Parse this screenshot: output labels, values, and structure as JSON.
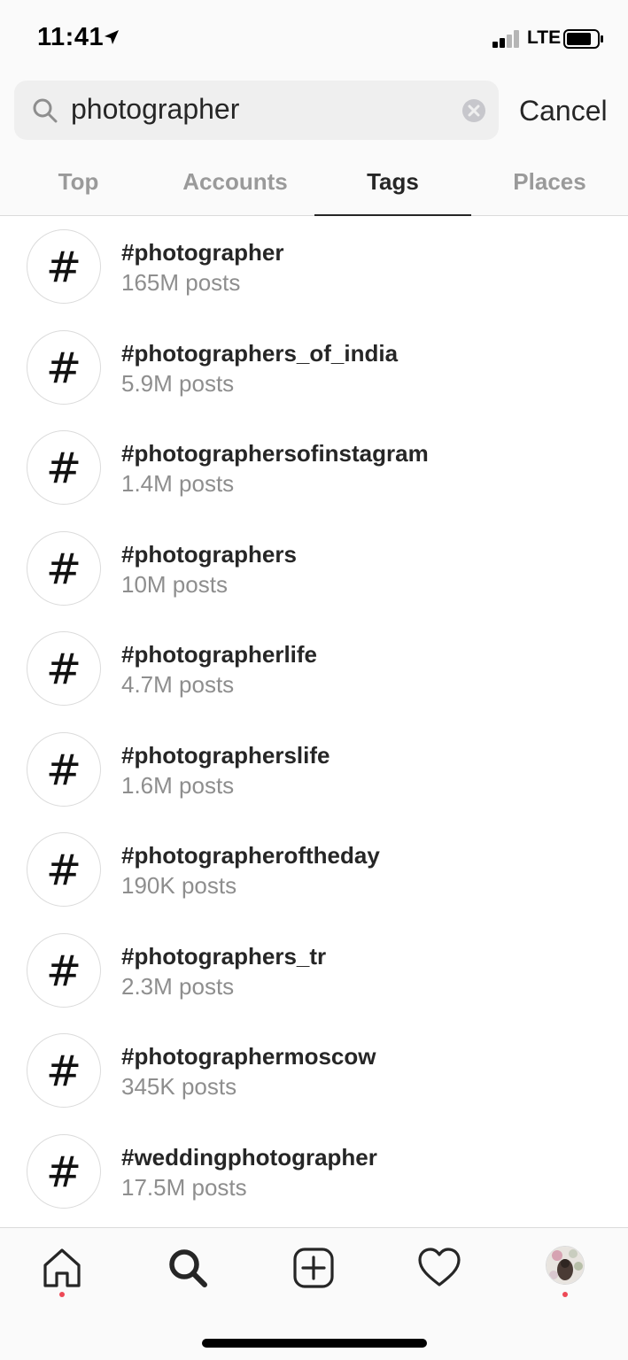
{
  "status_bar": {
    "time": "11:41",
    "network": "LTE"
  },
  "search": {
    "query": "photographer",
    "cancel_label": "Cancel"
  },
  "tabs": [
    {
      "label": "Top",
      "active": false
    },
    {
      "label": "Accounts",
      "active": false
    },
    {
      "label": "Tags",
      "active": true
    },
    {
      "label": "Places",
      "active": false
    }
  ],
  "tags": [
    {
      "symbol": "#",
      "name": "#photographer",
      "count": "165M posts"
    },
    {
      "symbol": "#",
      "name": "#photographers_of_india",
      "count": "5.9M posts"
    },
    {
      "symbol": "#",
      "name": "#photographersofinstagram",
      "count": "1.4M posts"
    },
    {
      "symbol": "#",
      "name": "#photographers",
      "count": "10M posts"
    },
    {
      "symbol": "#",
      "name": "#photographerlife",
      "count": "4.7M posts"
    },
    {
      "symbol": "#",
      "name": "#photographerslife",
      "count": "1.6M posts"
    },
    {
      "symbol": "#",
      "name": "#photographeroftheday",
      "count": "190K posts"
    },
    {
      "symbol": "#",
      "name": "#photographers_tr",
      "count": "2.3M posts"
    },
    {
      "symbol": "#",
      "name": "#photographermoscow",
      "count": "345K posts"
    },
    {
      "symbol": "#",
      "name": "#weddingphotographer",
      "count": "17.5M posts"
    }
  ],
  "bottom_nav": {
    "items": [
      "home-icon",
      "search-icon",
      "new-post-icon",
      "activity-heart-icon",
      "profile-avatar"
    ]
  },
  "colors": {
    "notification_dot": "#ed4956",
    "text_primary": "#262626",
    "text_secondary": "#8e8e8e"
  }
}
